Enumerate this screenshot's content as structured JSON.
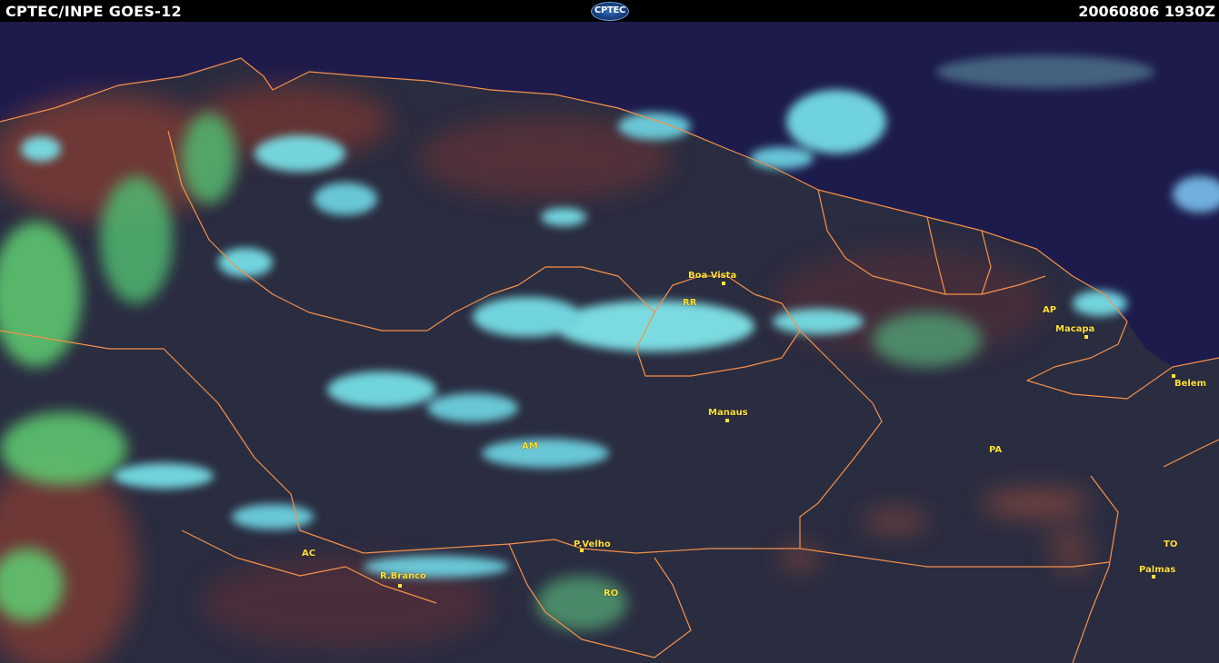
{
  "header": {
    "left_title": "CPTEC/INPE  GOES-12",
    "logo_text": "CPTEC",
    "timestamp": "20060806  1930Z"
  },
  "map": {
    "colors": {
      "ocean": "#1d1b4c",
      "land_dark": "#272a3d",
      "land_warm": "#7a3a35",
      "cloud_cyan": "#79e6ee",
      "cloud_green": "#5fcf72",
      "border": "#f3914a",
      "label": "#ffe23a"
    },
    "states": [
      {
        "id": "rr",
        "label": "RR"
      },
      {
        "id": "am",
        "label": "AM"
      },
      {
        "id": "ap",
        "label": "AP"
      },
      {
        "id": "pa",
        "label": "PA"
      },
      {
        "id": "ac",
        "label": "AC"
      },
      {
        "id": "ro",
        "label": "RO"
      },
      {
        "id": "to",
        "label": "TO"
      }
    ],
    "cities": [
      {
        "id": "boa-vista",
        "label": "Boa Vista"
      },
      {
        "id": "macapa",
        "label": "Macapa"
      },
      {
        "id": "belem",
        "label": "Belem"
      },
      {
        "id": "manaus",
        "label": "Manaus"
      },
      {
        "id": "p-velho",
        "label": "P.Velho"
      },
      {
        "id": "r-branco",
        "label": "R.Branco"
      },
      {
        "id": "palmas",
        "label": "Palmas"
      }
    ]
  }
}
